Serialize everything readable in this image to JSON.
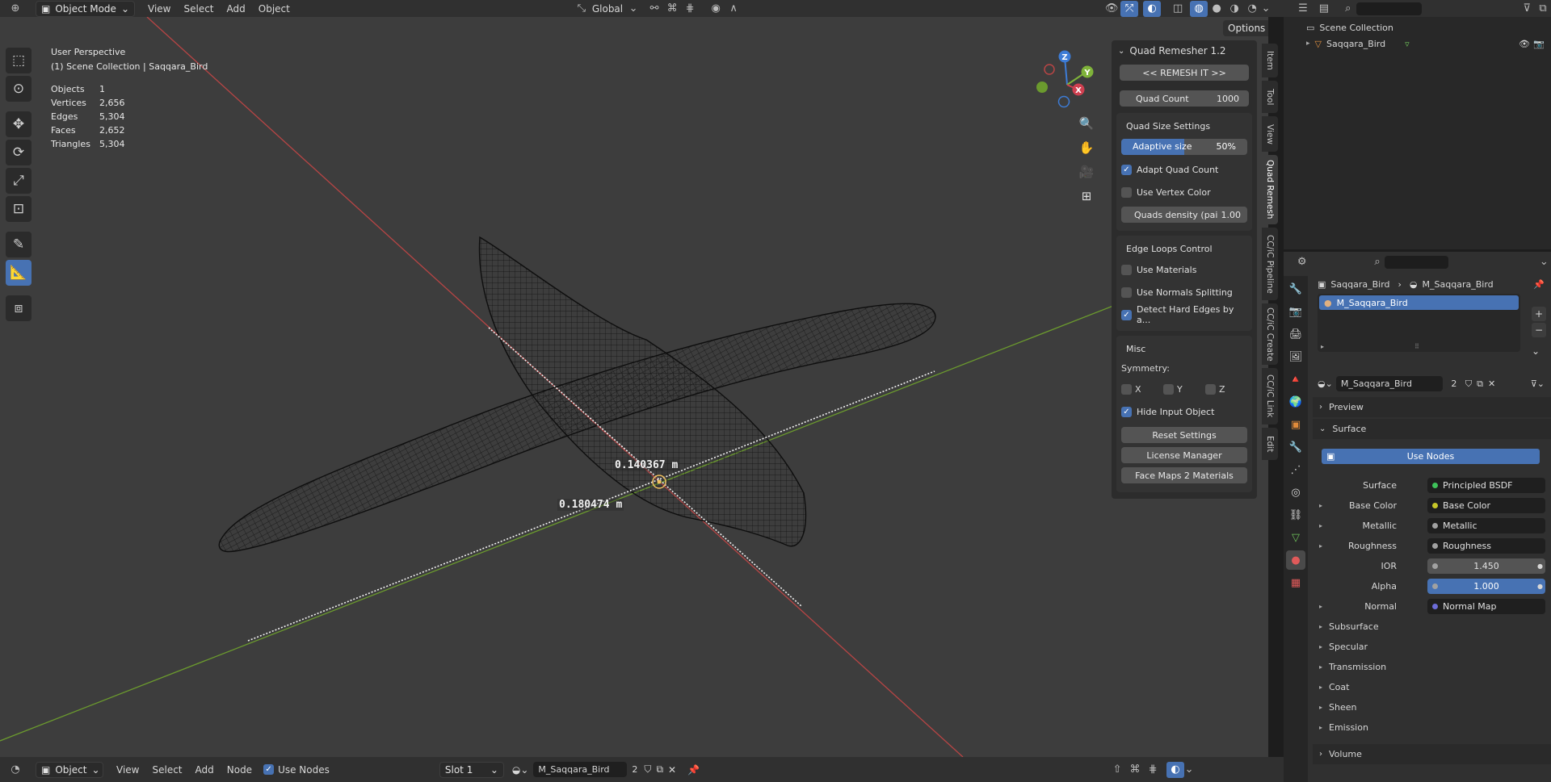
{
  "header": {
    "mode": "Object Mode",
    "menus": [
      "View",
      "Select",
      "Add",
      "Object"
    ],
    "transform_orientation": "Global",
    "options": "Options"
  },
  "viewport": {
    "view_name": "User Perspective",
    "collection_line": "(1) Scene Collection | Saqqara_Bird",
    "stats": [
      {
        "k": "Objects",
        "v": "1"
      },
      {
        "k": "Vertices",
        "v": "2,656"
      },
      {
        "k": "Edges",
        "v": "5,304"
      },
      {
        "k": "Faces",
        "v": "2,652"
      },
      {
        "k": "Triangles",
        "v": "5,304"
      }
    ],
    "measure_1": "0.140367 m",
    "measure_2": "0.180474 m",
    "gizmo": {
      "x": "X",
      "y": "Y",
      "z": "Z"
    }
  },
  "npanel": {
    "title": "Quad Remesher 1.2",
    "remesh_button": "<< REMESH IT >>",
    "quad_count_label": "Quad Count",
    "quad_count_value": "1000",
    "quad_size_title": "Quad Size Settings",
    "adaptive_label": "Adaptive size",
    "adaptive_value": "50%",
    "adaptive_fraction": 0.5,
    "adapt_quad_count": "Adapt Quad Count",
    "use_vertex_color": "Use Vertex Color",
    "quads_density_label": "Quads density (pai",
    "quads_density_value": "1.00",
    "edge_loops_title": "Edge Loops Control",
    "use_materials": "Use Materials",
    "use_normals_splitting": "Use Normals Splitting",
    "detect_hard_edges": "Detect Hard Edges by a...",
    "misc_title": "Misc",
    "symmetry_label": "Symmetry:",
    "sym_x": "X",
    "sym_y": "Y",
    "sym_z": "Z",
    "hide_input_object": "Hide Input Object",
    "reset_settings": "Reset Settings",
    "license_manager": "License Manager",
    "face_maps": "Face Maps 2 Materials"
  },
  "vtabs": [
    "Item",
    "Tool",
    "View",
    "Quad Remesh",
    "CC/iC Pipeline",
    "CC/iC Create",
    "CC/iC Link",
    "Edit"
  ],
  "outliner": {
    "scene_collection": "Scene Collection",
    "object": "Saqqara_Bird"
  },
  "properties": {
    "breadcrumb_object": "Saqqara_Bird",
    "breadcrumb_material": "M_Saqqara_Bird",
    "slot_item": "M_Saqqara_Bird",
    "material_name": "M_Saqqara_Bird",
    "users": "2",
    "preview": "Preview",
    "surface_panel": "Surface",
    "use_nodes": "Use Nodes",
    "surface_label": "Surface",
    "surface_value": "Principled BSDF",
    "rows": [
      {
        "label": "Base Color",
        "value": "Base Color",
        "sock": "#c7c729"
      },
      {
        "label": "Metallic",
        "value": "Metallic",
        "sock": "#a1a1a1"
      },
      {
        "label": "Roughness",
        "value": "Roughness",
        "sock": "#a1a1a1"
      }
    ],
    "ior_label": "IOR",
    "ior_value": "1.450",
    "alpha_label": "Alpha",
    "alpha_value": "1.000",
    "normal_label": "Normal",
    "normal_value": "Normal Map",
    "subpanels": [
      "Subsurface",
      "Specular",
      "Transmission",
      "Coat",
      "Sheen",
      "Emission"
    ],
    "volume": "Volume"
  },
  "bottom": {
    "mode": "Object",
    "menus": [
      "View",
      "Select",
      "Add",
      "Node"
    ],
    "use_nodes": "Use Nodes",
    "slot": "Slot 1",
    "material": "M_Saqqara_Bird",
    "users": "2"
  },
  "colors": {
    "accent": "#4772b3",
    "x_axis": "#c24a4a",
    "y_axis": "#6f9a2f"
  }
}
